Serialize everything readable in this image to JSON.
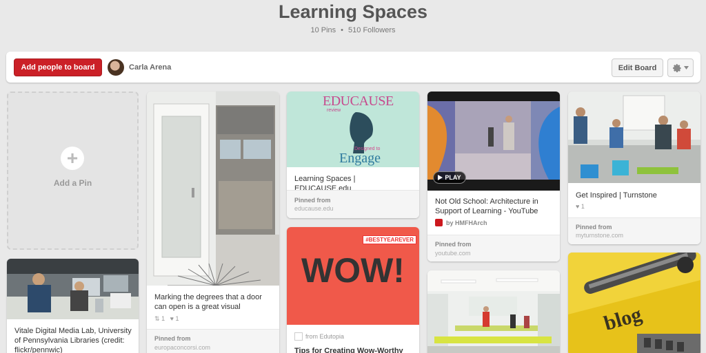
{
  "board": {
    "title": "Learning Spaces",
    "pins": "10 Pins",
    "separator": "•",
    "followers": "510 Followers"
  },
  "toolbar": {
    "add_people_label": "Add people to board",
    "owner_name": "Carla Arena",
    "edit_board_label": "Edit Board",
    "settings_icon": "gear-icon",
    "dropdown_icon": "chevron-down-icon"
  },
  "add_pin": {
    "plus": "+",
    "label": "Add a Pin"
  },
  "pins": [
    {
      "caption": "Vitale Digital Media Lab, University of Pennsylvania Libraries (credit: flickr/pennwic)"
    },
    {
      "caption": "Marking the degrees that a door can open is a great visual",
      "repins": "1",
      "likes": "1",
      "pinned_from_label": "Pinned from",
      "source": "europaconcorsi.com"
    },
    {
      "image_text": "EDUCAUSE",
      "image_subtext": "review",
      "image_tagline1": "Designed to",
      "image_tagline2": "Engage",
      "caption": "Learning Spaces | EDUCAUSE.edu",
      "pinned_from_label": "Pinned from",
      "source": "educause.edu"
    },
    {
      "image_tag": "#BESTYEAREVER",
      "image_text": "WOW!",
      "from_label": "from Edutopia",
      "caption": "Tips for Creating Wow-Worthy"
    },
    {
      "play_label": "PLAY",
      "caption": "Not Old School: Architecture in Support of Learning - YouTube",
      "by_label": "by HMFHArch",
      "pinned_from_label": "Pinned from",
      "source": "youtube.com"
    },
    {
      "caption": "Get Inspired | Turnstone",
      "likes": "1",
      "pinned_from_label": "Pinned from",
      "source": "myturnstone.com"
    },
    {
      "image_text": "blog"
    }
  ],
  "colors": {
    "background": "#e9e9e9",
    "brand_red": "#cb2027",
    "educause_bg": "#bfe6d9",
    "wow_bg": "#f0594a"
  }
}
